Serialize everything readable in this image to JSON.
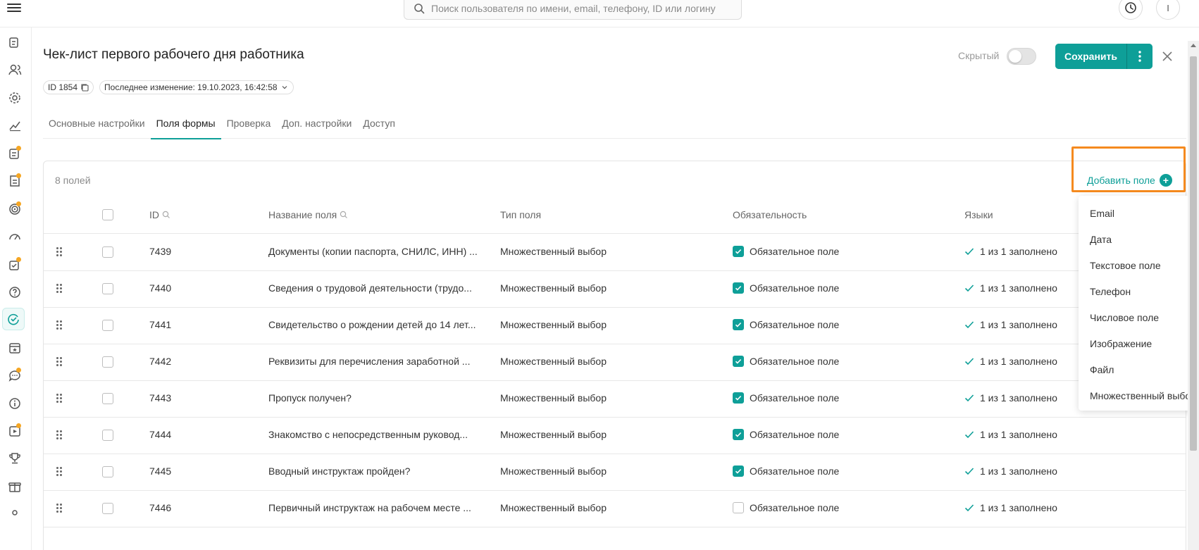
{
  "topbar": {
    "search_placeholder": "Поиск пользователя по имени, email, телефону, ID или логину",
    "avatar_initial": "I"
  },
  "rail": {
    "icons": [
      "form-edit-icon",
      "users-icon",
      "gear-icon",
      "chart-icon",
      "form-badge-icon",
      "document-badge-icon",
      "target-icon",
      "gauge-icon",
      "checklist-icon",
      "help-icon",
      "checklist-cycle-icon",
      "calendar-star-icon",
      "chat-badge-icon",
      "info-icon",
      "video-badge-icon",
      "trophy-icon",
      "gift-icon",
      "location-icon"
    ],
    "accent_dot_color": "#f5a623"
  },
  "header": {
    "title": "Чек-лист первого рабочего дня работника",
    "hidden_label": "Скрытый",
    "save_label": "Сохранить",
    "id_chip": "ID 1854",
    "last_modified": "Последнее изменение: 19.10.2023, 16:42:58"
  },
  "tabs": [
    {
      "label": "Основные настройки",
      "active": false
    },
    {
      "label": "Поля формы",
      "active": true
    },
    {
      "label": "Проверка",
      "active": false
    },
    {
      "label": "Доп. настройки",
      "active": false
    },
    {
      "label": "Доступ",
      "active": false
    }
  ],
  "table": {
    "count_label": "8 полей",
    "add_field_label": "Добавить поле",
    "columns": {
      "id": "ID",
      "name": "Название поля",
      "type": "Тип поля",
      "required": "Обязательность",
      "languages": "Языки"
    },
    "rows": [
      {
        "id": "7439",
        "name": "Документы (копии паспорта, СНИЛС, ИНН) ...",
        "type": "Множественный выбор",
        "required_label": "Обязательное поле",
        "required": true,
        "languages": "1 из 1 заполнено"
      },
      {
        "id": "7440",
        "name": "Сведения о трудовой деятельности (трудо...",
        "type": "Множественный выбор",
        "required_label": "Обязательное поле",
        "required": true,
        "languages": "1 из 1 заполнено"
      },
      {
        "id": "7441",
        "name": "Свидетельство о рождении детей до 14 лет...",
        "type": "Множественный выбор",
        "required_label": "Обязательное поле",
        "required": true,
        "languages": "1 из 1 заполнено"
      },
      {
        "id": "7442",
        "name": "Реквизиты для перечисления заработной ...",
        "type": "Множественный выбор",
        "required_label": "Обязательное поле",
        "required": true,
        "languages": "1 из 1 заполнено"
      },
      {
        "id": "7443",
        "name": "Пропуск получен?",
        "type": "Множественный выбор",
        "required_label": "Обязательное поле",
        "required": true,
        "languages": "1 из 1 заполнено"
      },
      {
        "id": "7444",
        "name": "Знакомство с непосредственным руковод...",
        "type": "Множественный выбор",
        "required_label": "Обязательное поле",
        "required": true,
        "languages": "1 из 1 заполнено"
      },
      {
        "id": "7445",
        "name": "Вводный инструктаж пройден?",
        "type": "Множественный выбор",
        "required_label": "Обязательное поле",
        "required": true,
        "languages": "1 из 1 заполнено"
      },
      {
        "id": "7446",
        "name": "Первичный инструктаж на рабочем месте ...",
        "type": "Множественный выбор",
        "required_label": "Обязательное поле",
        "required": false,
        "languages": "1 из 1 заполнено"
      }
    ]
  },
  "dropdown": {
    "items": [
      "Email",
      "Дата",
      "Текстовое поле",
      "Телефон",
      "Числовое поле",
      "Изображение",
      "Файл",
      "Множественный выбор"
    ]
  },
  "colors": {
    "accent": "#0e9f98",
    "highlight": "#f58a1f"
  }
}
